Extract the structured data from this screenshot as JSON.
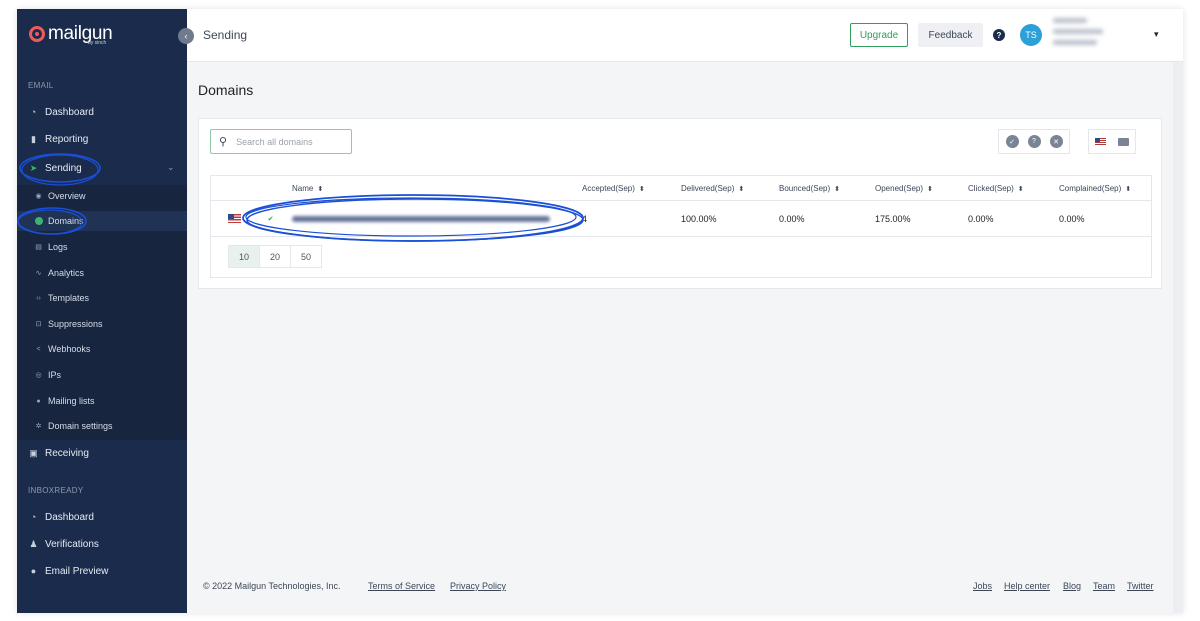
{
  "brand": {
    "name": "mailgun",
    "sub": "by sinch"
  },
  "sidebar": {
    "email_section": "EMAIL",
    "items": [
      {
        "label": "Dashboard",
        "icon": "dashboard-icon"
      },
      {
        "label": "Reporting",
        "icon": "bar-chart-icon"
      },
      {
        "label": "Sending",
        "icon": "paper-plane-icon"
      }
    ],
    "sending_sub": [
      {
        "label": "Overview",
        "icon": "eye-icon"
      },
      {
        "label": "Domains",
        "icon": "globe-icon"
      },
      {
        "label": "Logs",
        "icon": "document-icon"
      },
      {
        "label": "Analytics",
        "icon": "line-chart-icon"
      },
      {
        "label": "Templates",
        "icon": "code-icon"
      },
      {
        "label": "Suppressions",
        "icon": "block-icon"
      },
      {
        "label": "Webhooks",
        "icon": "share-icon"
      },
      {
        "label": "IPs",
        "icon": "location-icon"
      },
      {
        "label": "Mailing lists",
        "icon": "person-icon"
      },
      {
        "label": "Domain settings",
        "icon": "gear-icon"
      }
    ],
    "receiving": "Receiving",
    "inbox_section": "INBOXREADY",
    "inbox_items": [
      {
        "label": "Dashboard",
        "icon": "dashboard-icon"
      },
      {
        "label": "Verifications",
        "icon": "person-check-icon"
      },
      {
        "label": "Email Preview",
        "icon": "bulb-icon"
      }
    ]
  },
  "topbar": {
    "title": "Sending",
    "upgrade": "Upgrade",
    "feedback": "Feedback",
    "help": "?",
    "avatar_initials": "TS"
  },
  "page": {
    "title": "Domains",
    "search_placeholder": "Search all domains"
  },
  "table": {
    "columns": [
      "Name",
      "Accepted(Sep)",
      "Delivered(Sep)",
      "Bounced(Sep)",
      "Opened(Sep)",
      "Clicked(Sep)",
      "Complained(Sep)"
    ],
    "rows": [
      {
        "accepted": "4",
        "delivered": "100.00%",
        "bounced": "0.00%",
        "opened": "175.00%",
        "clicked": "0.00%",
        "complained": "0.00%"
      }
    ],
    "page_sizes": [
      "10",
      "20",
      "50"
    ]
  },
  "footer": {
    "copyright": "© 2022 Mailgun Technologies, Inc.",
    "terms": "Terms of Service",
    "privacy": "Privacy Policy",
    "links": [
      "Jobs",
      "Help center",
      "Blog",
      "Team",
      "Twitter"
    ]
  },
  "colors": {
    "sidebar": "#1b2b4b",
    "accent": "#2d9f5b",
    "annotation": "#1a4fd6"
  }
}
